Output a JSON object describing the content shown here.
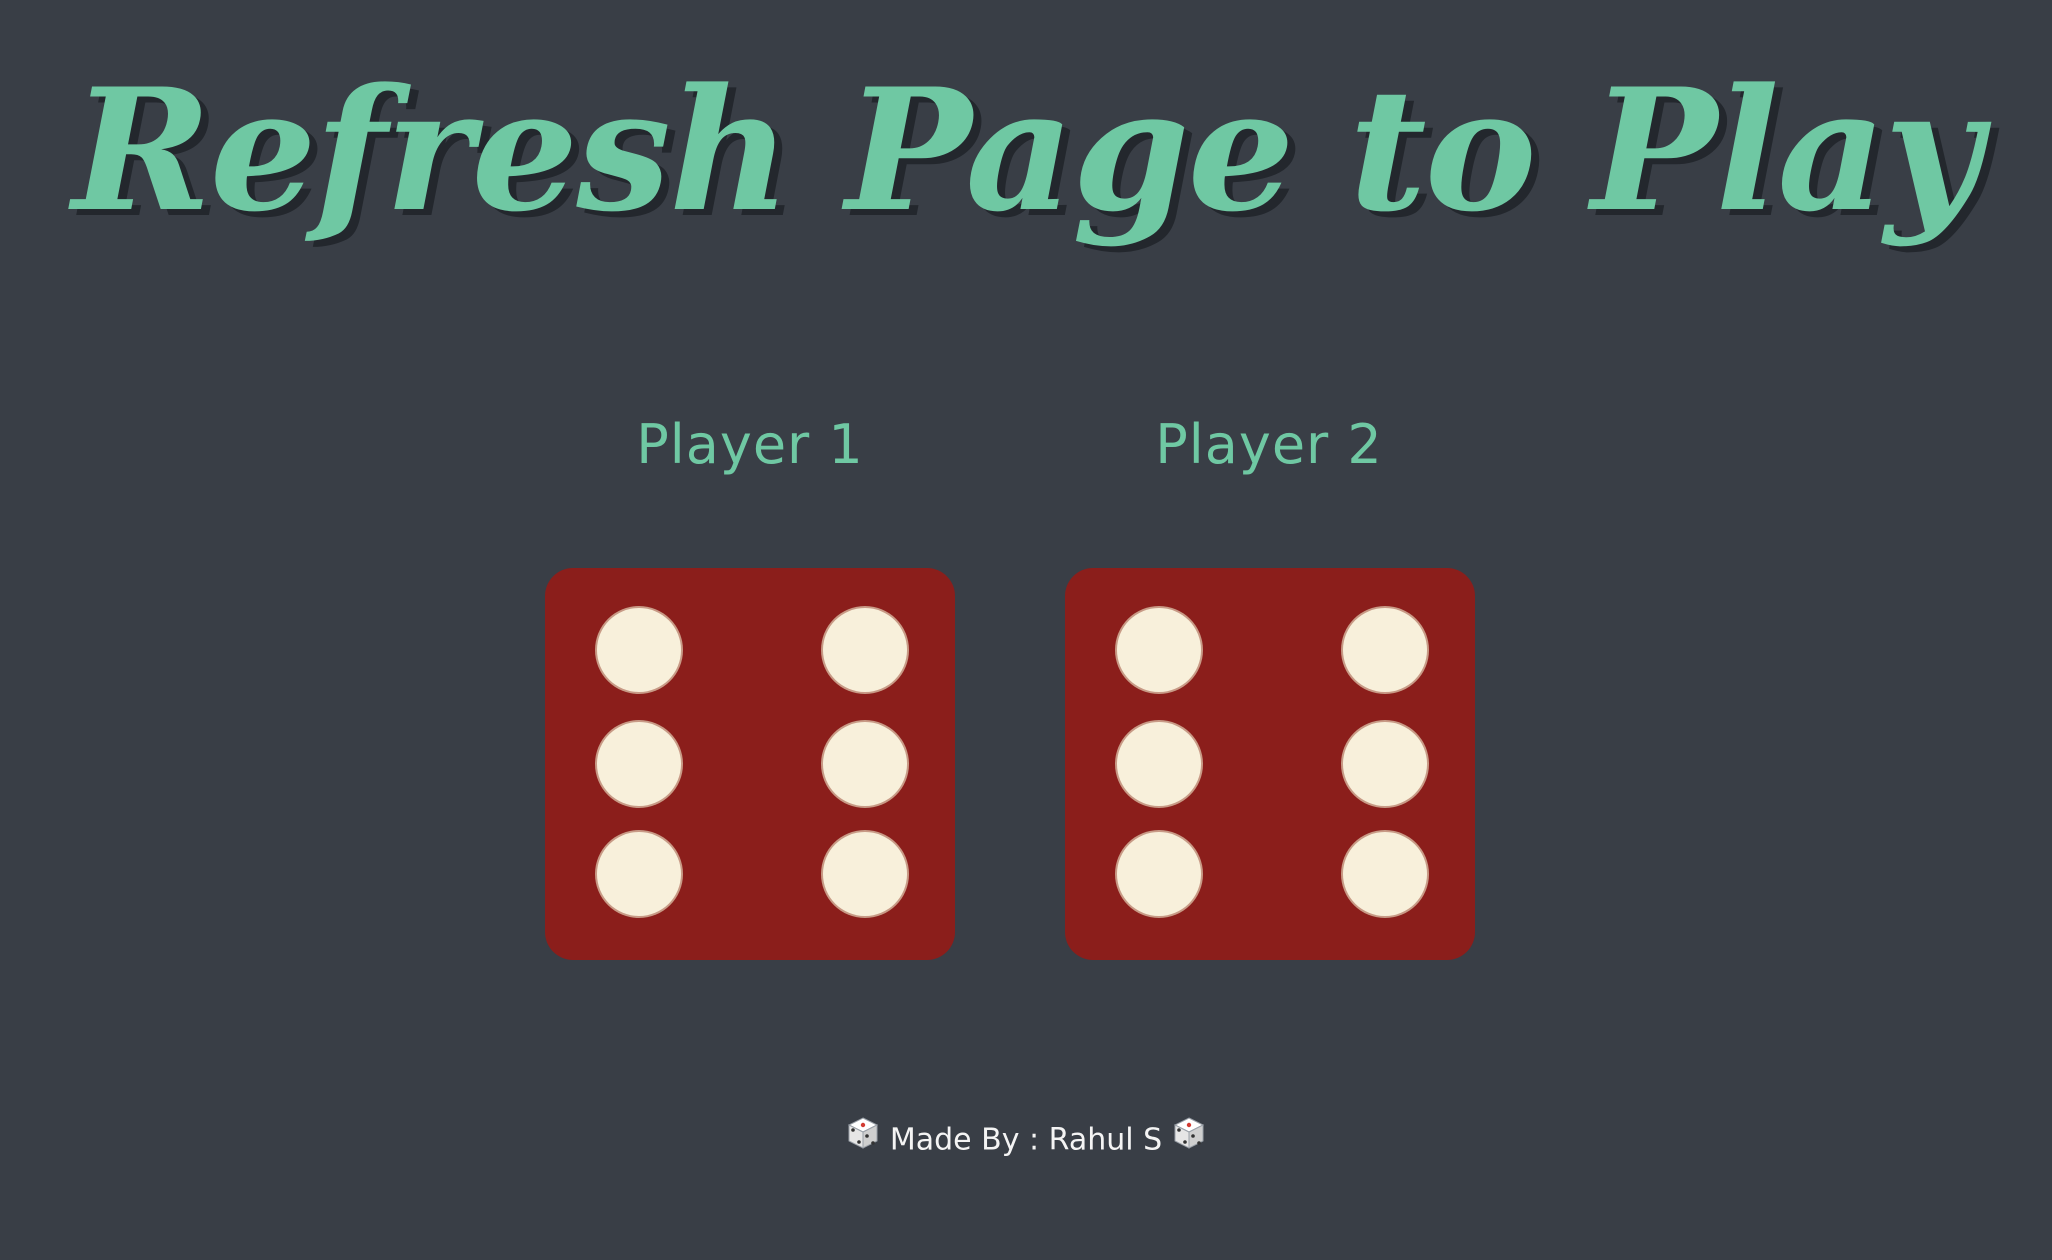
{
  "header": {
    "title": "Refresh Page to Play"
  },
  "players": [
    {
      "label": "Player 1",
      "die_value": 6
    },
    {
      "label": "Player 2",
      "die_value": 6
    }
  ],
  "footer": {
    "text": "Made By : Rahul S",
    "icon": "dice-icon"
  },
  "colors": {
    "background": "#393e46",
    "accent": "#6fc8a3",
    "die_face": "#8b1e1b",
    "pip": "#f8f0db",
    "footer_text": "#f4f4f4"
  }
}
